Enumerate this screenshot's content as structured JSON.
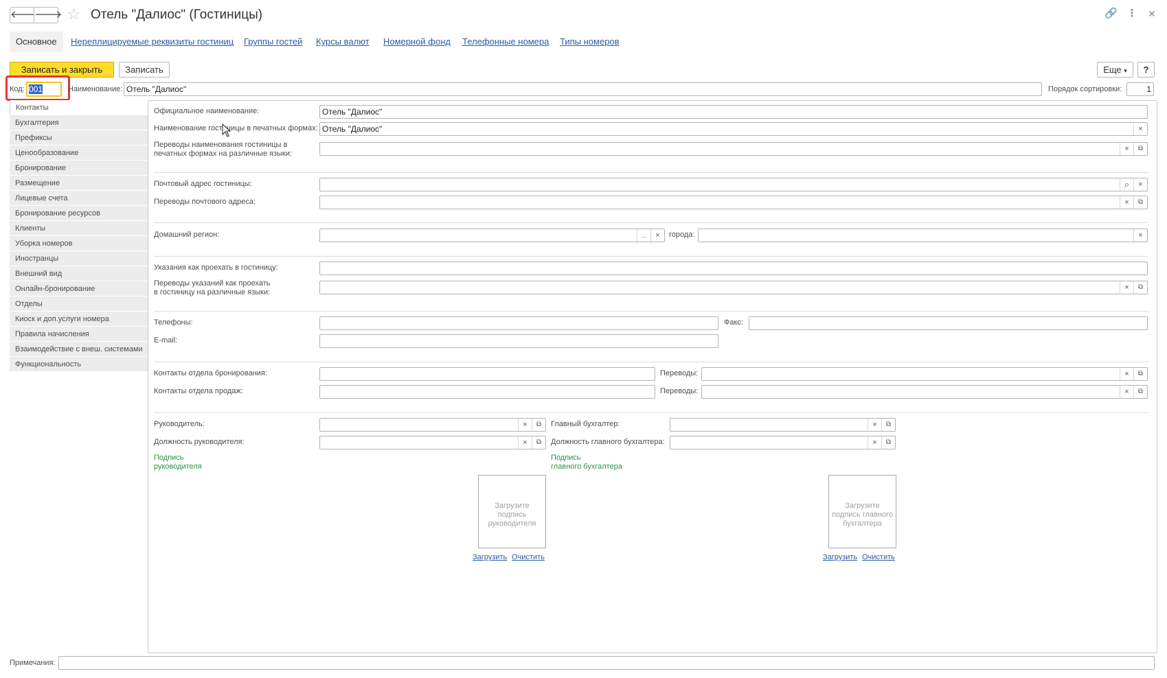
{
  "window": {
    "title": "Отель \"Далиос\" (Гостиницы)",
    "icons": {
      "back": "arrow-left-icon",
      "forward": "arrow-right-icon",
      "favorite": "star-icon",
      "link": "link-icon",
      "more": "more-vertical-icon",
      "close": "close-icon"
    }
  },
  "tabs": {
    "active": "Основное",
    "links": [
      "Нереплицируемые реквизиты гостиниц",
      "Группы гостей",
      "Курсы валют",
      "Номерной фонд",
      "Телефонные номера",
      "Типы номеров"
    ]
  },
  "toolbar": {
    "save_close": "Записать и закрыть",
    "save": "Записать",
    "more": "Еще",
    "help": "?"
  },
  "header_fields": {
    "code_label": "Код:",
    "code_value": "001",
    "name_label": "Наименование:",
    "name_value": "Отель \"Далиос\"",
    "sort_label": "Порядок сортировки:",
    "sort_value": "1"
  },
  "menu": {
    "items": [
      "Контакты",
      "Бухгалтерия",
      "Префиксы",
      "Ценообразование",
      "Бронирование",
      "Размещение",
      "Лицевые счета",
      "Бронирование ресурсов",
      "Клиенты",
      "Уборка номеров",
      "Иностранцы",
      "Внешний вид",
      "Онлайн-бронирование",
      "Отделы",
      "Киоск и доп.услуги номера",
      "Правила начисления",
      "Взаимодействие с внеш. системами",
      "Функциональность"
    ],
    "active_index": 0
  },
  "form": {
    "official_name_label": "Официальное наименование:",
    "official_name_value": "Отель \"Далиос\"",
    "print_name_label": "Наименование гостиницы в печатных формах:",
    "print_name_value": "Отель \"Далиос\"",
    "print_name_translations_label_1": "Переводы наименования гостиницы в",
    "print_name_translations_label_2": "печатных формах на различные языки:",
    "postal_address_label": "Почтовый адрес гостиницы:",
    "postal_translations_label": "Переводы почтового адреса:",
    "home_region_label": "Домашний регион:",
    "city_label": "города:",
    "directions_label": "Указания как проехать в гостиницу:",
    "directions_translations_label_1": "Переводы указаний как проехать",
    "directions_translations_label_2": "в гостиницу на различные языки:",
    "phones_label": "Телефоны:",
    "fax_label": "Факс:",
    "email_label": "E-mail:",
    "booking_contacts_label": "Контакты отдела бронирования:",
    "sales_contacts_label": "Контакты отдела продаж:",
    "translations_label": "Переводы:",
    "director_label": "Руководитель:",
    "director_position_label": "Должность руководителя:",
    "chief_accountant_label": "Главный бухгалтер:",
    "chief_accountant_position_label": "Должность главного бухгалтера:",
    "director_signature_1": "Подпись",
    "director_signature_2": "руководителя",
    "accountant_signature_1": "Подпись",
    "accountant_signature_2": "главного бухгалтера",
    "director_sig_placeholder_1": "Загрузите",
    "director_sig_placeholder_2": "подпись",
    "director_sig_placeholder_3": "руководителя",
    "accountant_sig_placeholder_1": "Загрузите",
    "accountant_sig_placeholder_2": "подпись главного",
    "accountant_sig_placeholder_3": "бухгалтера",
    "upload": "Загрузить",
    "clear": "Очистить"
  },
  "notes": {
    "label": "Примечания:"
  },
  "symbols": {
    "clear": "×",
    "open": "⧉",
    "select": "...",
    "search": "⌕",
    "dropdown": "▾"
  }
}
